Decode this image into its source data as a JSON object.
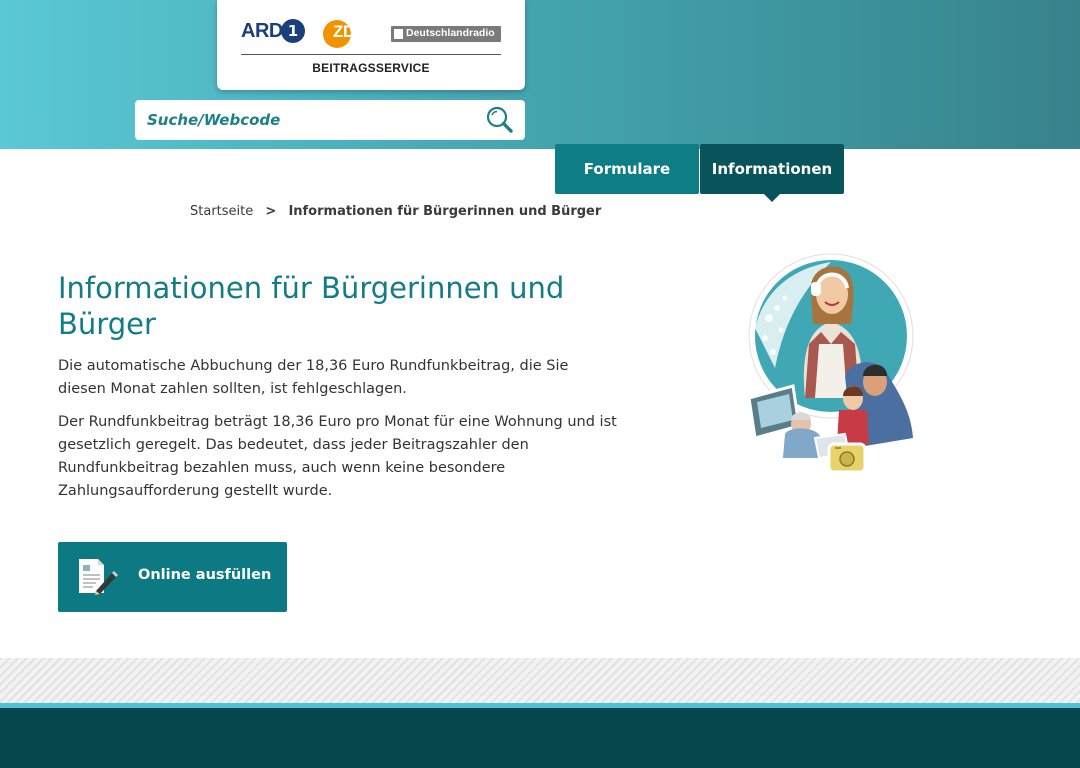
{
  "header": {
    "logo": {
      "ard_text": "ARD",
      "ard_mark": "1",
      "zdf_text": "ZDF",
      "dlr_text": "Deutschlandradio",
      "subtitle": "BEITRAGSSERVICE"
    },
    "search": {
      "placeholder": "Suche/Webcode",
      "icon": "search-icon"
    }
  },
  "nav": {
    "tabs": [
      {
        "label": "Formulare",
        "active": false
      },
      {
        "label": "Informationen",
        "active": true
      }
    ]
  },
  "breadcrumb": {
    "home": "Startseite",
    "separator": ">",
    "current": "Informationen für Bürgerinnen und Bürger"
  },
  "main": {
    "title": "Informationen für Bürgerinnen und Bürger",
    "paragraphs": [
      "Die automatische Abbuchung der 18,36 Euro Rundfunkbeitrag, die Sie diesen Monat zahlen sollten, ist fehlgeschlagen.",
      "Der Rundfunkbeitrag beträgt 18,36 Euro pro Monat für eine Wohnung und ist gesetzlich geregelt. Das bedeutet, dass jeder Beitragszahler den Rundfunkbeitrag bezahlen muss, auch wenn keine besondere Zahlungsaufforderung gestellt wurde."
    ],
    "cta": {
      "label": "Online ausfüllen",
      "icon": "document-pen-icon"
    }
  },
  "colors": {
    "accent": "#137c87",
    "tab_inactive": "#0f7d85",
    "tab_active": "#09535a",
    "footer": "#07484f",
    "footer_stripe": "#4fc3d2"
  }
}
